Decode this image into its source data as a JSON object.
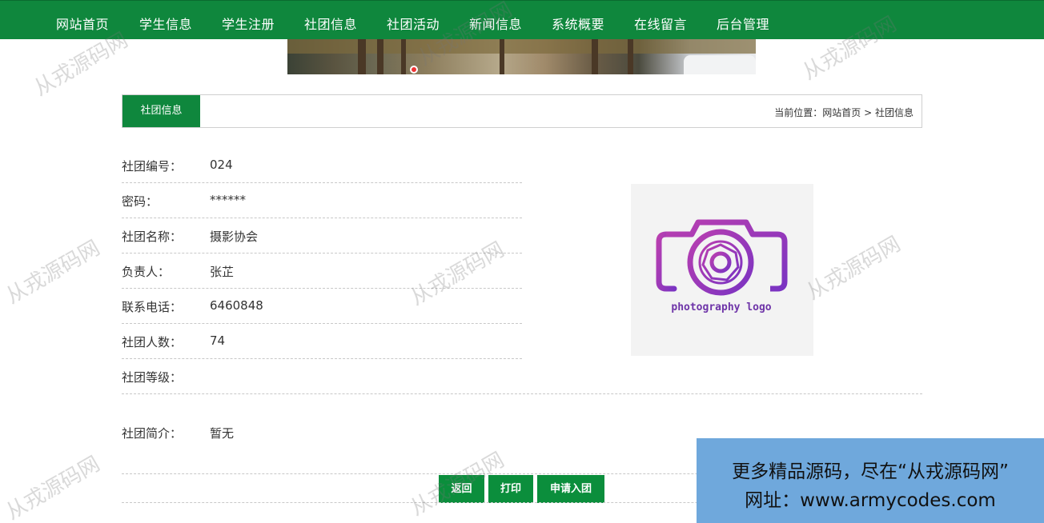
{
  "nav": {
    "items": [
      "网站首页",
      "学生信息",
      "学生注册",
      "社团信息",
      "社团活动",
      "新闻信息",
      "系统概要",
      "在线留言",
      "后台管理"
    ]
  },
  "section": {
    "tab_label": "社团信息",
    "breadcrumb_prefix": "当前位置：",
    "breadcrumb_home": "网站首页",
    "breadcrumb_sep": ">",
    "breadcrumb_current": "社团信息"
  },
  "details": [
    {
      "label": "社团编号：",
      "value": "024"
    },
    {
      "label": "密码：",
      "value": "******"
    },
    {
      "label": "社团名称：",
      "value": "摄影协会"
    },
    {
      "label": "负责人：",
      "value": "张芷"
    },
    {
      "label": "联系电话：",
      "value": "6460848"
    },
    {
      "label": "社团人数：",
      "value": "74"
    },
    {
      "label": "社团等级：",
      "value": ""
    }
  ],
  "intro": {
    "label": "社团简介：",
    "value": "暂无"
  },
  "logo": {
    "text": "photography logo",
    "color": "#9b38b8"
  },
  "buttons": {
    "back": "返回",
    "print": "打印",
    "apply": "申请入团"
  },
  "watermark": "从戎源码网",
  "promo": {
    "line1": "更多精品源码，尽在“从戎源码网”",
    "line2": "网址：www.armycodes.com"
  },
  "colors": {
    "primary": "#0f873d",
    "promo_bg": "#6fa8dc"
  }
}
